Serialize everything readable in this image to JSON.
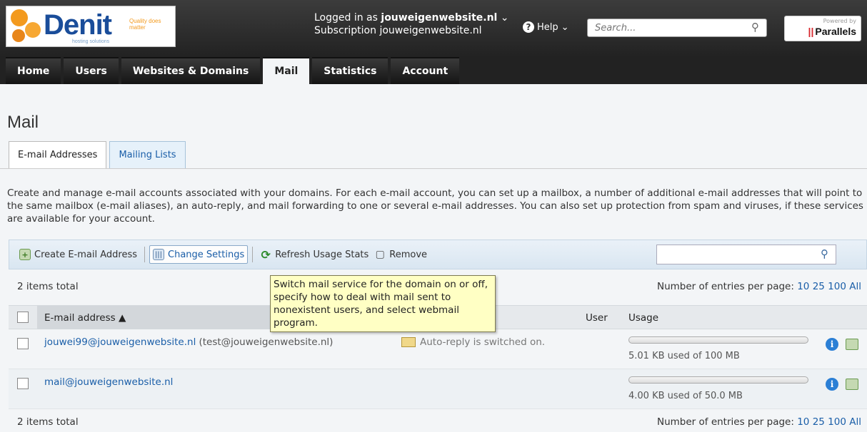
{
  "brand": {
    "name": "Denit",
    "tagline": "Quality does matter",
    "subtitle": "hosting solutions"
  },
  "header": {
    "logged_in_prefix": "Logged in as",
    "logged_in_user": "jouweigenwebsite.nl",
    "subscription_prefix": "Subscription",
    "subscription_value": "jouweigenwebsite.nl",
    "help_label": "Help",
    "search_placeholder": "Search...",
    "powered_by": "Powered by",
    "powered_by_brand": "Parallels"
  },
  "nav": {
    "tabs": [
      {
        "label": "Home",
        "active": false
      },
      {
        "label": "Users",
        "active": false
      },
      {
        "label": "Websites & Domains",
        "active": false
      },
      {
        "label": "Mail",
        "active": true
      },
      {
        "label": "Statistics",
        "active": false
      },
      {
        "label": "Account",
        "active": false
      }
    ]
  },
  "page": {
    "title": "Mail",
    "subtabs": [
      {
        "label": "E-mail Addresses",
        "active": true
      },
      {
        "label": "Mailing Lists",
        "active": false
      }
    ],
    "description": "Create and manage e-mail accounts associated with your domains. For each e-mail account, you can set up a mailbox, a number of additional e-mail addresses that will point to the same mailbox (e-mail aliases), an auto-reply, and mail forwarding to one or several e-mail addresses. You can also set up protection from spam and viruses, if these services are available for your account."
  },
  "toolbar": {
    "create_label": "Create E-mail Address",
    "settings_label": "Change Settings",
    "refresh_label": "Refresh Usage Stats",
    "remove_label": "Remove"
  },
  "tooltip": {
    "text": "Switch mail service for the domain on or off, specify how to deal with mail sent to nonexistent users, and select webmail program."
  },
  "list": {
    "items_total": "2 items total",
    "per_page_label": "Number of entries per page:",
    "per_page_options": [
      "10",
      "25",
      "100",
      "All"
    ],
    "columns": {
      "email": "E-mail address",
      "user": "User",
      "usage": "Usage"
    },
    "rows": [
      {
        "email": "jouwei99@jouweigenwebsite.nl",
        "alias": "(test@jouweigenwebsite.nl)",
        "status": "Auto-reply is switched on.",
        "usage_text": "5.01 KB used of 100 MB",
        "usage_fraction": 0.0
      },
      {
        "email": "mail@jouweigenwebsite.nl",
        "alias": "",
        "status": "",
        "usage_text": "4.00 KB used of 50.0 MB",
        "usage_fraction": 0.0
      }
    ]
  }
}
